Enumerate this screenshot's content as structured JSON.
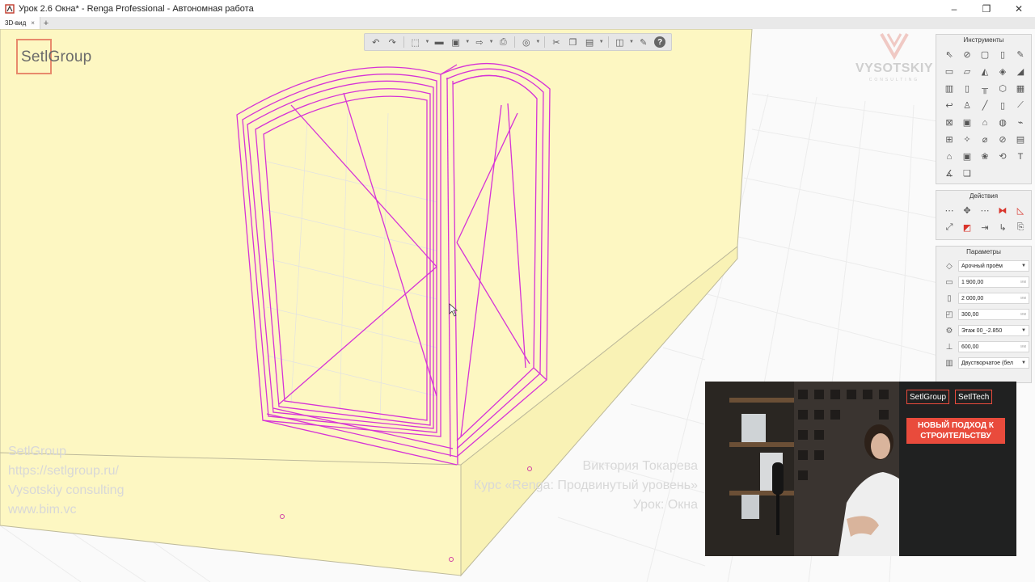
{
  "window": {
    "title": "Урок 2.6 Окна* - Renga Professional - Автономная работа",
    "controls": {
      "minimize": "–",
      "maximize": "❐",
      "close": "✕"
    }
  },
  "tabs": [
    {
      "label": "3D-вид",
      "close": "×"
    }
  ],
  "tab_add": "+",
  "toolbar": {
    "icons": [
      "undo-icon",
      "redo-icon",
      "view-cube-icon",
      "section-icon",
      "save-icon",
      "export-icon",
      "print-icon",
      "visibility-icon",
      "cut-icon",
      "copy-icon",
      "paste-icon",
      "layers-icon",
      "settings-icon",
      "help-icon"
    ],
    "help_label": "?"
  },
  "logos": {
    "setlgroup": "SetlGroup",
    "vysotskiy": "VYSOTSKIY",
    "vysotskiy_sub": "CONSULTING"
  },
  "tools_panel": {
    "title": "Инструменты",
    "icons": [
      "select-icon",
      "axis-icon",
      "rectangle-icon",
      "column-icon",
      "pencil-icon",
      "wall-icon",
      "beam-icon",
      "roof-icon",
      "slab-icon",
      "ramp-icon",
      "door-icon",
      "window-icon",
      "railing-icon",
      "room-icon",
      "stair-icon",
      "pipe-icon",
      "fitting-icon",
      "line-icon",
      "equipment-icon",
      "duct-icon",
      "opening-icon",
      "terminal-icon",
      "plumbing-icon",
      "cable-tray-icon",
      "rebar-icon",
      "dimension-icon",
      "level-icon",
      "elevation-icon",
      "chain-icon",
      "section-view-icon",
      "symbol-icon",
      "cable-icon",
      "assembly-icon",
      "annotation-icon",
      "text-icon",
      "angle-icon",
      "shapes-icon"
    ]
  },
  "actions_panel": {
    "title": "Действия",
    "icons": [
      "move-icon",
      "rotate-icon",
      "array-icon",
      "mirror-icon",
      "trim-icon",
      "extend-icon",
      "delete-icon",
      "offset-icon",
      "align-icon",
      "copy-props-icon"
    ]
  },
  "params_panel": {
    "title": "Параметры",
    "rows": [
      {
        "icon": "style-icon",
        "value": "Арочный проём",
        "dropdown": true
      },
      {
        "icon": "width-icon",
        "value": "1 900,00",
        "unit": "мм"
      },
      {
        "icon": "height-icon",
        "value": "2 000,00",
        "unit": "мм"
      },
      {
        "icon": "depth-icon",
        "value": "300,00",
        "unit": "мм"
      },
      {
        "icon": "level-icon",
        "value": "Этаж 00_-2.850",
        "dropdown": true
      },
      {
        "icon": "offset-icon",
        "value": "600,00",
        "unit": "мм"
      },
      {
        "icon": "frame-icon",
        "value": "Двустворчатое (бел",
        "dropdown": true
      }
    ]
  },
  "video": {
    "banner_logo_1": "SetlGroup",
    "banner_logo_2": "SetlTech",
    "banner_headline": "НОВЫЙ ПОДХОД К СТРОИТЕЛЬСТВУ"
  },
  "watermark_left": [
    "SetlGroup",
    "https://setlgroup.ru/",
    "Vysotskiy consulting",
    "www.bim.vc"
  ],
  "watermark_right": [
    "Виктория Токарева",
    "Курс «Renga: Продвинутый уровень»",
    "Урок: Окна"
  ]
}
